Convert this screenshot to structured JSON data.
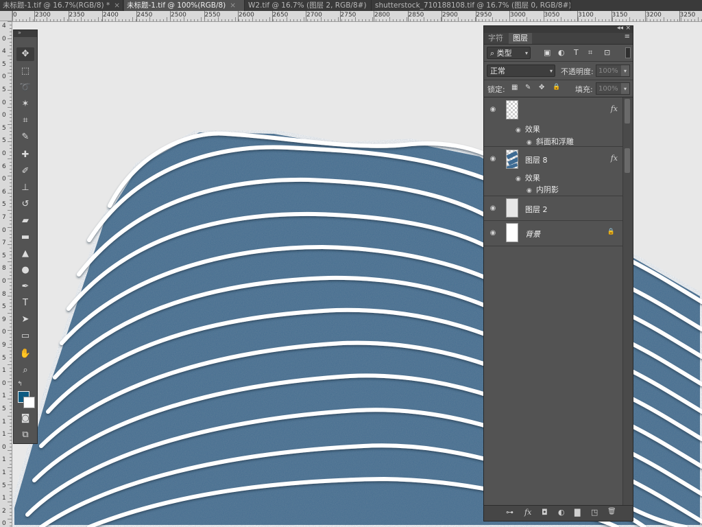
{
  "tabs": [
    {
      "label": "未标题-1.tif @ 16.7%(RGB/8) *",
      "active": false
    },
    {
      "label": "未标题-1.tif @ 100%(RGB/8)",
      "active": true
    },
    {
      "label": "W2.tif @ 16.7% (图层 2, RGB/8#)",
      "active": false
    },
    {
      "label": "shutterstock_710188108.tif @ 16.7% (图层 0, RGB/8#) *",
      "active": false
    }
  ],
  "tab_close_glyph": "×",
  "ruler": {
    "h_labels": [
      "0",
      "2300",
      "2350",
      "2400",
      "2450",
      "2500",
      "2550",
      "2600",
      "2650",
      "2700",
      "2750",
      "2800",
      "2850",
      "2900",
      "2950",
      "3000",
      "3050",
      "3100",
      "3150",
      "3200",
      "3250",
      "3300",
      "335"
    ],
    "v_labels": [
      "4",
      "0",
      "4",
      "5",
      "0",
      "5",
      "0",
      "0",
      "5",
      "5",
      "0",
      "6",
      "0",
      "6",
      "5",
      "7",
      "0",
      "7",
      "5",
      "8",
      "0",
      "8",
      "5",
      "9",
      "0",
      "9",
      "5",
      "1",
      "0",
      "1",
      "5",
      "1",
      "1",
      "0",
      "1",
      "1",
      "5",
      "1",
      "2",
      "0"
    ]
  },
  "tools": {
    "grip_label": "»",
    "items": [
      {
        "name": "move-tool",
        "glyph": "✥",
        "selected": true
      },
      {
        "name": "marquee-tool",
        "glyph": "⬚"
      },
      {
        "name": "lasso-tool",
        "glyph": "➰"
      },
      {
        "name": "magic-wand-tool",
        "glyph": "✶"
      },
      {
        "name": "crop-tool",
        "glyph": "⌗"
      },
      {
        "name": "eyedropper-tool",
        "glyph": "✎"
      },
      {
        "name": "healing-brush-tool",
        "glyph": "✚"
      },
      {
        "name": "brush-tool",
        "glyph": "✐"
      },
      {
        "name": "clone-stamp-tool",
        "glyph": "⊥"
      },
      {
        "name": "history-brush-tool",
        "glyph": "↺"
      },
      {
        "name": "eraser-tool",
        "glyph": "▰"
      },
      {
        "name": "gradient-tool",
        "glyph": "▬"
      },
      {
        "name": "blur-tool",
        "glyph": "▲"
      },
      {
        "name": "dodge-tool",
        "glyph": "●"
      },
      {
        "name": "pen-tool",
        "glyph": "✒"
      },
      {
        "name": "type-tool",
        "glyph": "T"
      },
      {
        "name": "path-selection-tool",
        "glyph": "➤"
      },
      {
        "name": "shape-tool",
        "glyph": "▭"
      },
      {
        "name": "hand-tool",
        "glyph": "✋"
      },
      {
        "name": "zoom-tool",
        "glyph": "⌕"
      }
    ],
    "swatch_glyph": "↰",
    "fg_color": "#0e5b82",
    "bg_color": "#ffffff",
    "quickmask_glyph": "◙",
    "screenmode_glyph": "⧉"
  },
  "layers_panel": {
    "titlebar_collapse": "◂◂",
    "titlebar_close": "×",
    "tab_character": "字符",
    "tab_layers": "图层",
    "menu_glyph": "≡",
    "filter_dropdown": "类型",
    "filter_search_glyph": "⌕",
    "filter_icons": [
      "▣",
      "◐",
      "T",
      "⌗",
      "⊡"
    ],
    "blend_mode": "正常",
    "opacity_label": "不透明度:",
    "opacity_value": "100%",
    "lock_label": "锁定:",
    "lock_icons": [
      "▦",
      "✎",
      "✥",
      "🔒"
    ],
    "fill_label": "填充:",
    "fill_value": "100%",
    "dropdown_arrow": "▾",
    "layers": [
      {
        "name": "",
        "fx": "fx",
        "effects_label": "效果",
        "effects": [
          "斜面和浮雕"
        ],
        "thumb": "checker"
      },
      {
        "name": "图层 8",
        "fx": "fx",
        "effects_label": "效果",
        "effects": [
          "内阴影"
        ],
        "thumb": "pattern"
      },
      {
        "name": "图层 2",
        "thumb": "light"
      },
      {
        "name": "背景",
        "thumb": "white",
        "locked": true
      }
    ],
    "eye_glyph": "◉",
    "lock_glyph": "🔒",
    "bottom_icons": [
      {
        "name": "link-layers-icon",
        "glyph": "⊶"
      },
      {
        "name": "add-style-icon",
        "glyph": "fx"
      },
      {
        "name": "add-mask-icon",
        "glyph": "◘"
      },
      {
        "name": "adjustment-layer-icon",
        "glyph": "◐"
      },
      {
        "name": "new-group-icon",
        "glyph": "▇"
      },
      {
        "name": "new-layer-icon",
        "glyph": "◳"
      },
      {
        "name": "delete-layer-icon",
        "glyph": "🗑"
      }
    ]
  },
  "colors": {
    "canvas_bg": "#e8e8e8",
    "artwork_blue": "#456d8f",
    "stripe_white": "#ffffff"
  }
}
